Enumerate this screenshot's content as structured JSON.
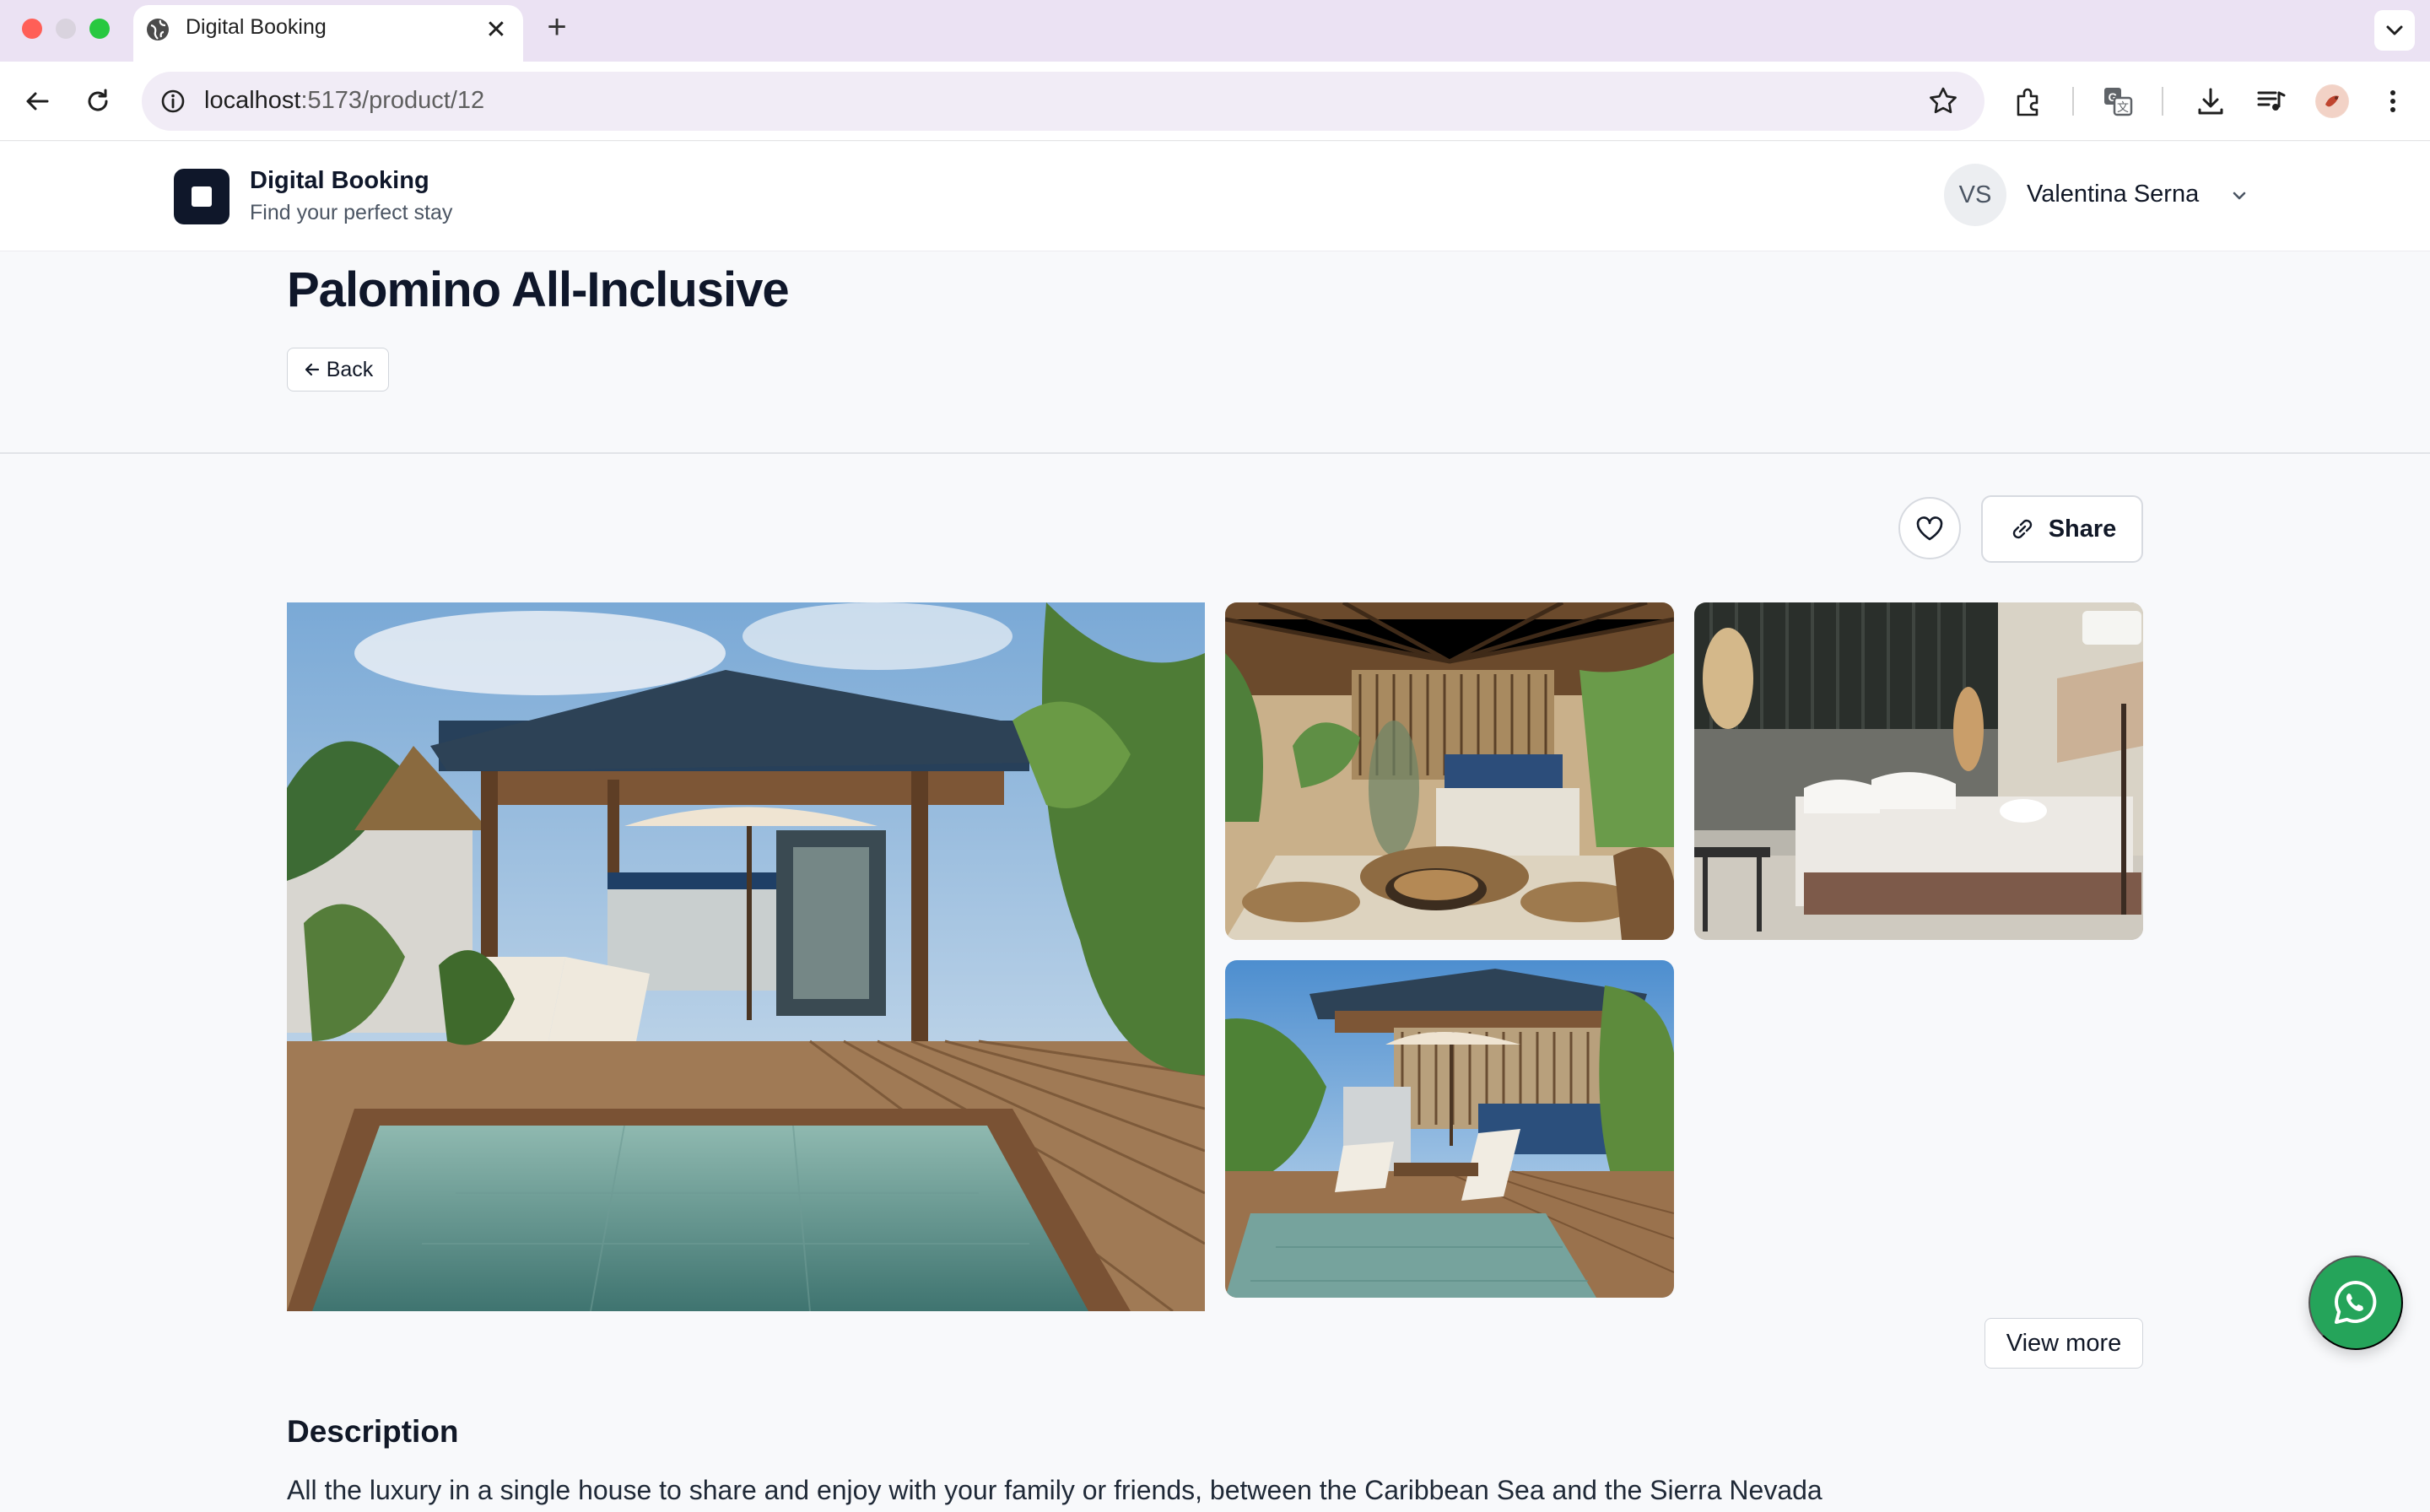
{
  "browser": {
    "tab_title": "Digital Booking",
    "url_host": "localhost",
    "url_rest": ":5173/product/12",
    "icons": [
      "globe-icon",
      "close-icon",
      "plus-icon",
      "chevron-down-icon",
      "back-arrow-icon",
      "reload-icon",
      "info-icon",
      "star-icon",
      "extensions-icon",
      "translate-icon",
      "download-icon",
      "media-icon",
      "profile-icon",
      "more-icon"
    ]
  },
  "header": {
    "brand_name": "Digital Booking",
    "brand_tagline": "Find your perfect stay",
    "user_initials": "VS",
    "user_name": "Valentina Serna"
  },
  "product": {
    "title": "Palomino All-Inclusive",
    "back_label": "Back",
    "share_label": "Share",
    "view_more_label": "View more",
    "description_heading": "Description",
    "description_text": "All the luxury in a single house to share and enjoy with your family or friends, between the Caribbean Sea and the Sierra Nevada",
    "gallery": [
      {
        "id": "main",
        "subject": "pool-pergola"
      },
      {
        "id": "2",
        "subject": "dining-terrace"
      },
      {
        "id": "3",
        "subject": "bedroom"
      },
      {
        "id": "4",
        "subject": "pool-loungers"
      }
    ]
  },
  "colors": {
    "brand": "#0f172a",
    "whatsapp": "#25a45a",
    "page_bg": "#f8f9fb"
  }
}
